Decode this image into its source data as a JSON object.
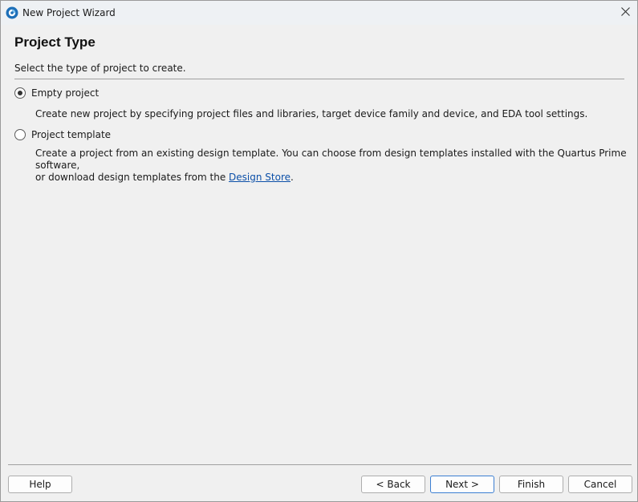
{
  "window": {
    "title": "New Project Wizard"
  },
  "header": {
    "title": "Project Type",
    "subtitle": "Select the type of project to create."
  },
  "options": [
    {
      "label": "Empty project",
      "selected": true,
      "description": "Create new project by specifying project files and libraries, target device family and device, and EDA tool settings."
    },
    {
      "label": "Project template",
      "selected": false,
      "description_line1": "Create a project from an existing design template. You can choose from design templates installed with the Quartus Prime software,",
      "description_line2_prefix": "or download design templates from the ",
      "description_link": "Design Store",
      "description_line2_suffix": "."
    }
  ],
  "footer": {
    "help_label": "Help",
    "back_label": "< Back",
    "next_label": "Next >",
    "finish_label": "Finish",
    "cancel_label": "Cancel"
  },
  "icons": {
    "app": "app-logo-icon",
    "close": "close-icon"
  },
  "colors": {
    "link": "#0b4fa8",
    "default_button_border": "#3c7fd2"
  }
}
